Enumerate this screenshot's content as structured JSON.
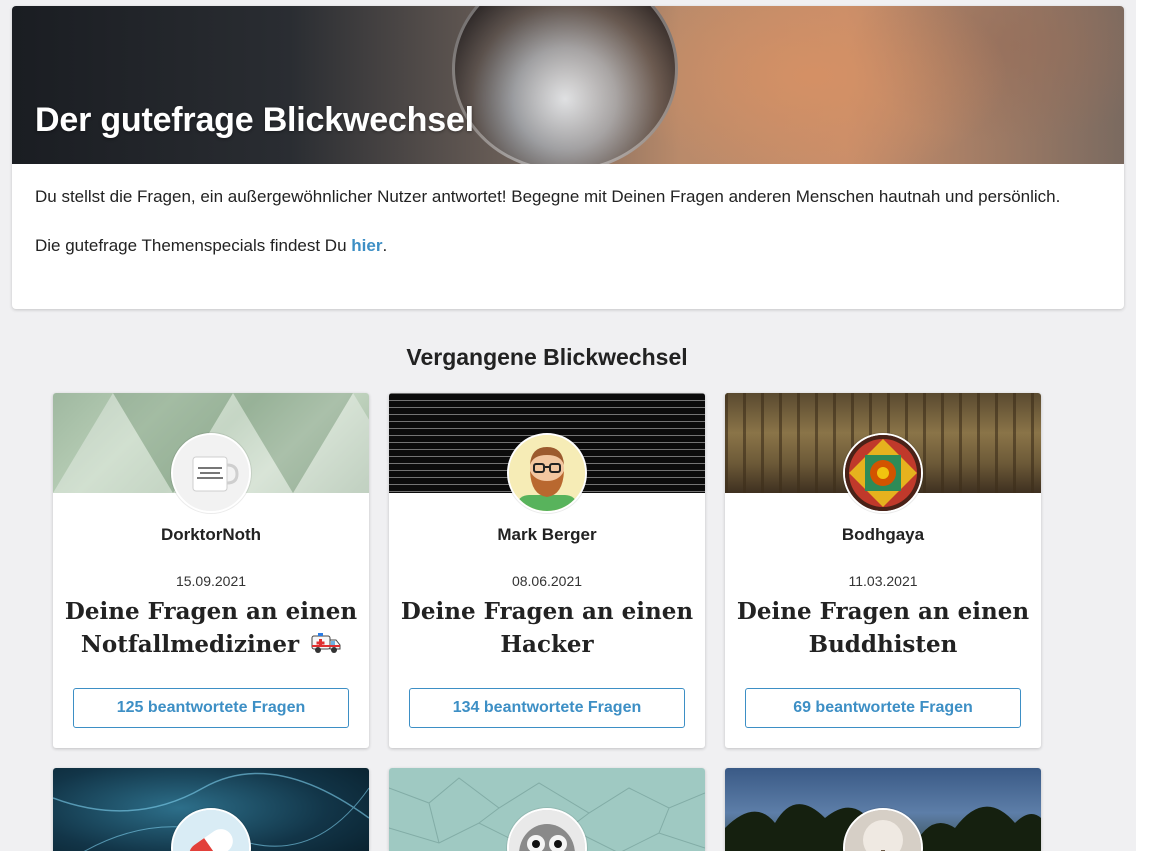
{
  "hero": {
    "title": "Der gutefrage Blickwechsel",
    "intro": "Du stellst die Fragen, ein außergewöhnlicher Nutzer antwortet! Begegne mit Deinen Fragen anderen Menschen hautnah und persönlich.",
    "specials_prefix": "Die gutefrage Themenspecials findest Du ",
    "specials_link": "hier",
    "specials_suffix": "."
  },
  "section": {
    "heading": "Vergangene Blickwechsel"
  },
  "cards": [
    {
      "author": "DorktorNoth",
      "date": "15.09.2021",
      "title": "Deine Fragen an einen Notfallmediziner",
      "title_icon": "ambulance-icon",
      "button": "125 beantwortete Fragen"
    },
    {
      "author": "Mark Berger",
      "date": "08.06.2021",
      "title": "Deine Fragen an einen Hacker",
      "button": "134 beantwortete Fragen"
    },
    {
      "author": "Bodhgaya",
      "date": "11.03.2021",
      "title": "Deine Fragen an einen Buddhisten",
      "button": "69 beantwortete Fragen"
    }
  ],
  "colors": {
    "accent": "#3d8fc5",
    "background": "#f0f0f2"
  }
}
